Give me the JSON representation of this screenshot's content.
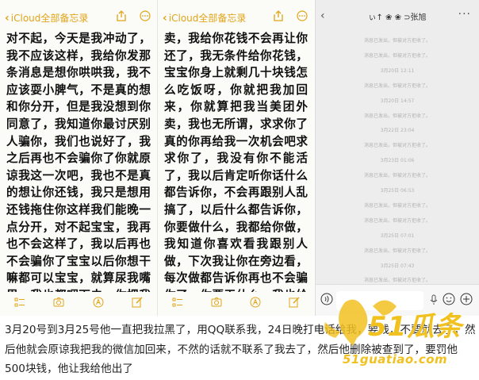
{
  "left_note": {
    "back_label": "iCloud全部备忘录",
    "body": "对不起，今天是我冲动了，我不应该这样，我给你发那条消息是想你哄哄我，我不应该耍小脾气，不是真的想和你分开，但是我没想到你同意了，我知道你最讨厌别人骗你，我们也说好了，我之后再也不会骗你了你就原谅我这一次吧，我也不是真的想让你还钱，我只是想用还钱拖住你这样我们能晚一点分开，对不起宝宝，我再也不会这样了，我以后再也不会骗你了宝宝以后你想干嘛都可以宝宝，就算尿我嘴里，我也都咽下去，你把我加回来吧，我给你点外卖，我给你花钱不会再让"
  },
  "right_note": {
    "back_label": "iCloud全部备忘录",
    "body": "卖，我给你花钱不会再让你还了，我无条件给你花钱，宝宝你身上就剩几十块钱怎么吃饭呀，你就把我加回来，你就算把我当美团外卖，我也无所谓，求求你了真的你再给我一次机会吧求求你了，我没有你不能活了，我以后肯定听你话什么都告诉你，不会再跟别人乱搞了，以后什么都告诉你，你要做什么，我都给你做，我知道你喜欢看我跟别人做，下次我让你在旁边看，每次做都告诉你再也不会骗你了，你要干什么，我也给你看手机你也随便翻。求你了，在原谅我这最后一次"
  },
  "chat": {
    "title": "ぃ↑ ❀ ❀ ⊃张旭",
    "rows": [
      {
        "text": "消息已发出，但被对方拒收了。"
      },
      {
        "text": "消息已发出，但被对方拒收了。"
      },
      {
        "text": "3月20日 12:11"
      },
      {
        "text": "消息已发出，但被对方拒收了。"
      },
      {
        "text": "3月20日 14:57"
      },
      {
        "text": "消息已发出，但被对方拒收了。"
      },
      {
        "text": "3月22日 23:04"
      },
      {
        "text": "消息已发出，但被对方拒收了。"
      },
      {
        "text": "3月23日 01:06"
      },
      {
        "text": "消息已发出，但被对方拒收了。"
      },
      {
        "text": "3月25日 06:53"
      },
      {
        "text": "消息已发出，但被对方拒收了。"
      },
      {
        "text": "消息已发出，但被对方拒收了。"
      },
      {
        "text": "3月25日 07:01"
      },
      {
        "text": "消息已发出，但被对方拒收了。"
      },
      {
        "text": "3月25日 07:43"
      },
      {
        "text": "消息已发出，但被对方拒收了。"
      }
    ]
  },
  "caption": "3月20号到3月25号他一直把我拉黑了，用QQ联系我，24日晚打电话给我，要钱，不要就去了，然后他就会原谅我把我的微信加回来，不然的话就不联系了我去了，然后他删除被查到了，要罚他500块钱，他让我给他出了",
  "watermark": {
    "brand": "51瓜条",
    "domain": "51guatiao.com",
    "color": "#f1c120"
  },
  "colors": {
    "note_accent": "#e0a418",
    "chat_bg": "#ededed",
    "system_msg": "#b2b2b2"
  }
}
